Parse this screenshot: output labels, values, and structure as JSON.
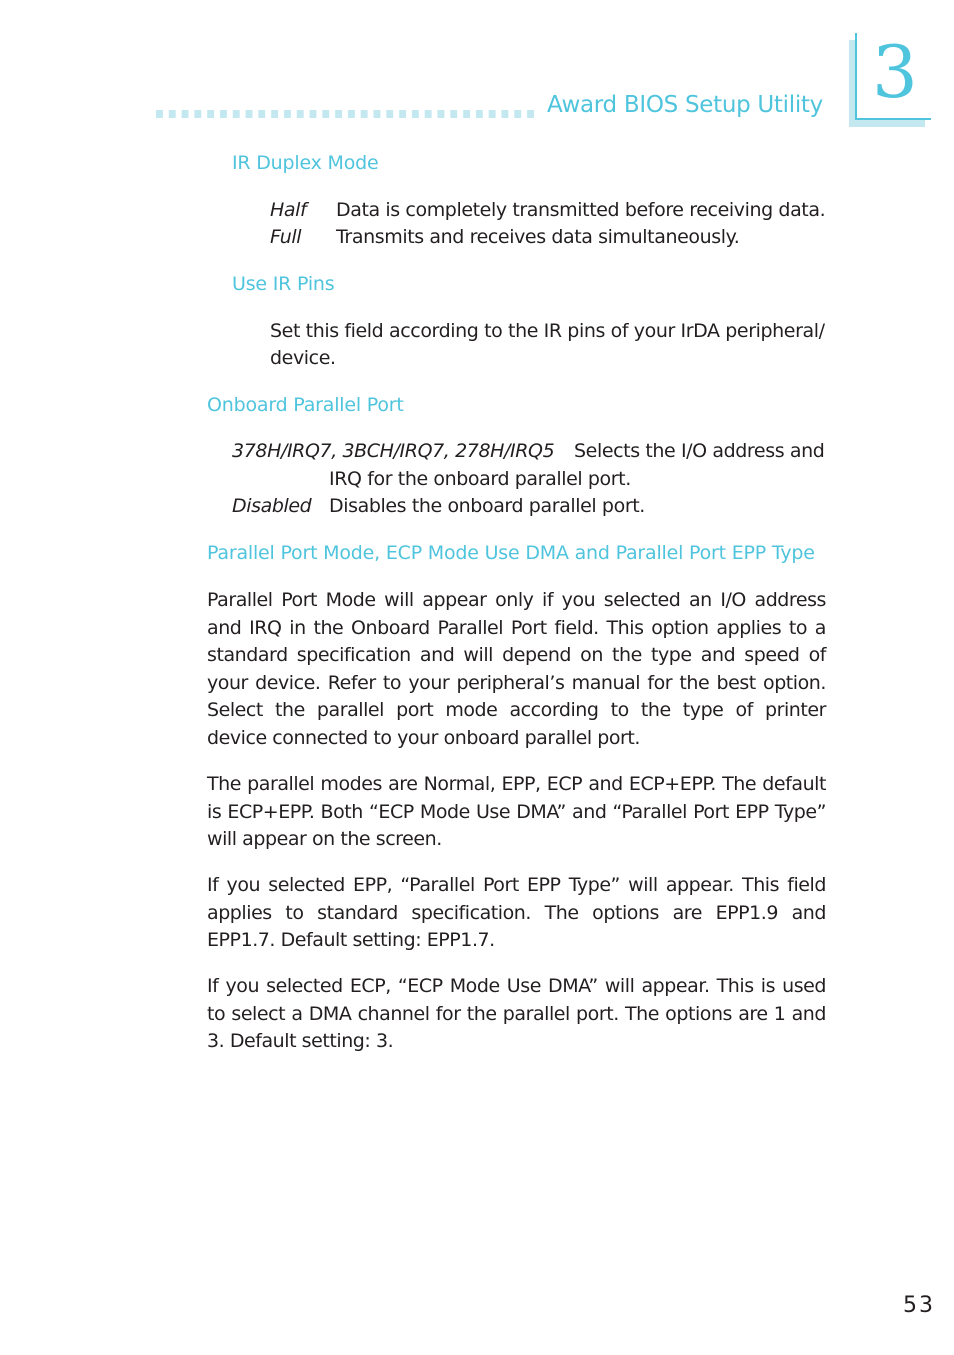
{
  "header": {
    "title": "Award BIOS Setup Utility",
    "chapter_number": "3",
    "accent_color": "#4fc4dd",
    "accent_light_color": "#c4e8f0"
  },
  "sections": {
    "ir_duplex": {
      "heading": "IR Duplex Mode",
      "options": [
        {
          "term": "Half",
          "description": "Data is completely transmitted before receiving data."
        },
        {
          "term": "Full",
          "description": "Transmits and receives data simultaneously."
        }
      ]
    },
    "use_ir_pins": {
      "heading": "Use IR Pins",
      "body_line1": "Set this field according to the IR pins of your IrDA peripheral/",
      "body_line2": "device."
    },
    "onboard_parallel": {
      "heading": "Onboard Parallel Port",
      "options": [
        {
          "term": "378H/IRQ7, 3BCH/IRQ7, 278H/IRQ5",
          "description_line1": "Selects the I/O address and",
          "description_line2": "IRQ for the onboard parallel port."
        },
        {
          "term": "Disabled",
          "description": "Disables the onboard parallel port."
        }
      ]
    },
    "parallel_mode": {
      "heading": "Parallel Port Mode, ECP Mode Use DMA and Parallel Port EPP Type",
      "paragraphs": [
        "Parallel Port Mode will appear only if you selected an I/O address and IRQ in the Onboard Parallel Port field. This option applies to a standard specification and will depend on the type and speed of your device. Refer to your peripheral’s manual for the best option. Select the parallel port mode according to the type of printer device connected to your onboard parallel port.",
        "The parallel modes are Normal, EPP, ECP and ECP+EPP. The default is ECP+EPP. Both “ECP Mode Use DMA” and “Parallel Port EPP Type” will appear on the screen.",
        "If you selected EPP, “Parallel Port EPP Type” will appear. This field applies to standard specification. The options are EPP1.9 and EPP1.7. Default setting: EPP1.7.",
        "If you selected ECP, “ECP Mode Use DMA” will appear. This is used to select a DMA channel for the parallel port. The options are 1 and 3. Default setting: 3."
      ]
    }
  },
  "footer": {
    "page_number": "53"
  }
}
